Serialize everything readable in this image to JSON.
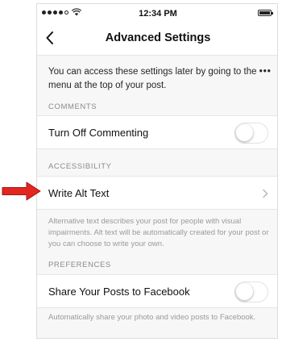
{
  "status_bar": {
    "time": "12:34 PM",
    "signal_icon": "signal-dots-icon",
    "wifi_icon": "wifi-icon",
    "battery_icon": "battery-icon"
  },
  "nav": {
    "back_icon": "chevron-left-icon",
    "title": "Advanced Settings"
  },
  "intro": {
    "text_before": "You can access these settings later by going to the",
    "menu_glyph": "•••",
    "text_after": "menu at the top of your post."
  },
  "sections": {
    "comments": {
      "header": "COMMENTS",
      "row_label": "Turn Off Commenting",
      "toggle_on": false
    },
    "accessibility": {
      "header": "ACCESSIBILITY",
      "row_label": "Write Alt Text",
      "chevron_icon": "chevron-right-icon",
      "footnote": "Alternative text describes your post for people with visual impairments. Alt text will be automatically created for your post or you can choose to write your own."
    },
    "preferences": {
      "header": "PREFERENCES",
      "row_label": "Share Your Posts to Facebook",
      "toggle_on": false,
      "footnote": "Automatically share your photo and video posts to Facebook."
    }
  },
  "annotation": {
    "arrow_icon": "red-arrow-icon",
    "arrow_color": "#e3261f"
  }
}
